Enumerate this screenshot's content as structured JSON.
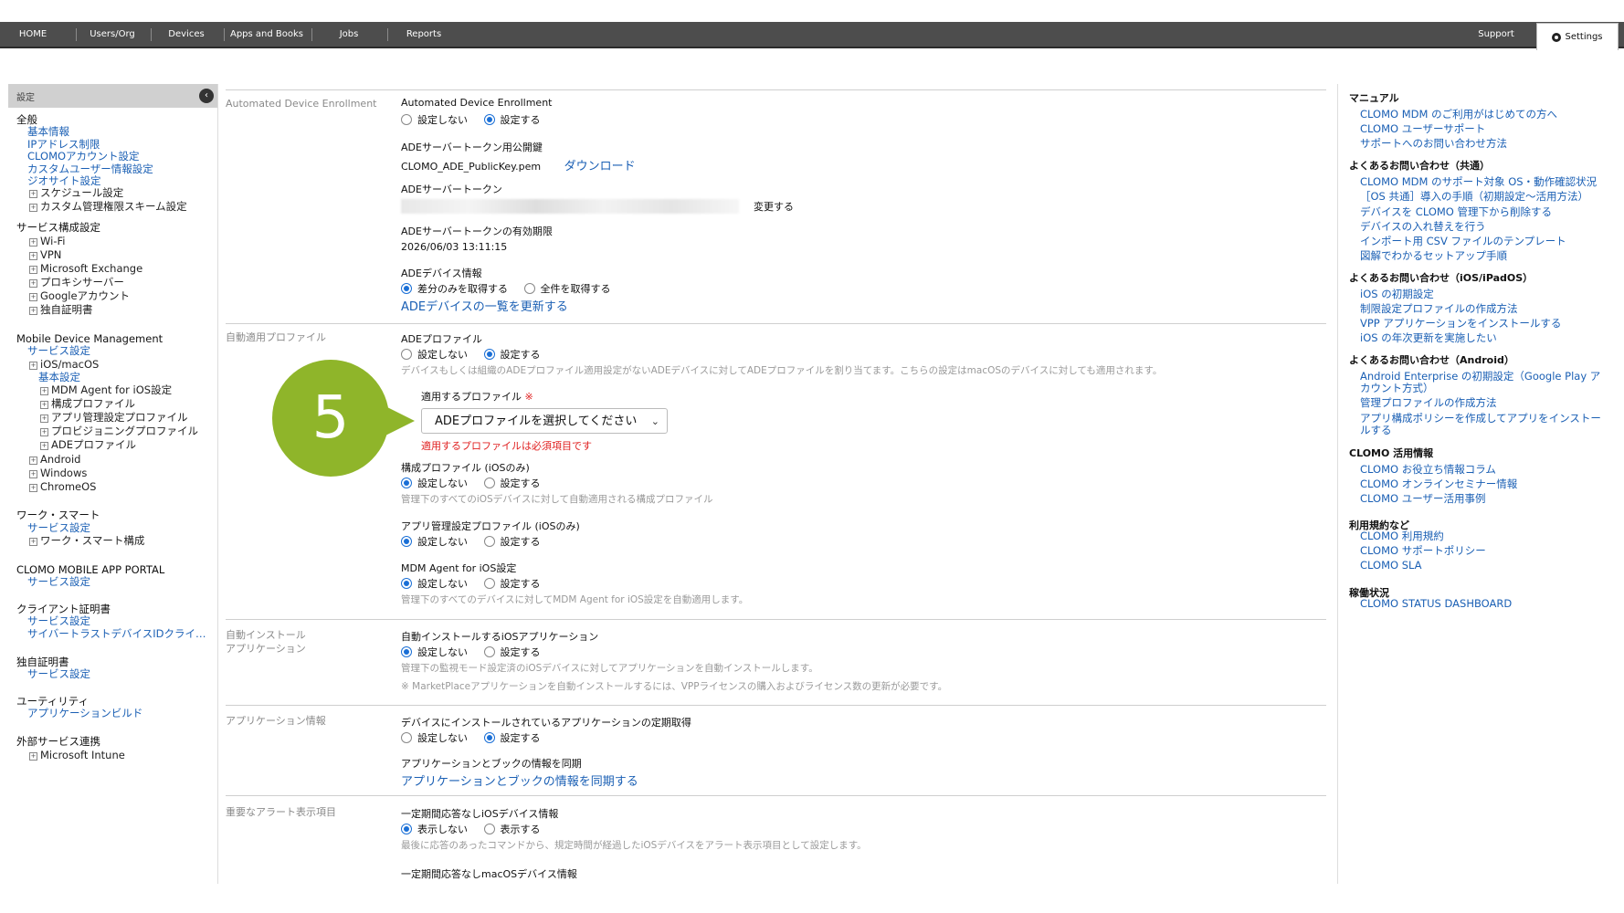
{
  "nav": {
    "items": [
      "HOME",
      "Users/Org",
      "Devices",
      "Apps and Books",
      "Jobs",
      "Reports"
    ],
    "support": "Support",
    "settings": "Settings"
  },
  "sidebar": {
    "title": "設定",
    "entries": [
      {
        "text": "全般",
        "kind": "head"
      },
      {
        "text": "基本情報",
        "kind": "lnk"
      },
      {
        "text": "IPアドレス制限",
        "kind": "lnk"
      },
      {
        "text": "CLOMOアカウント設定",
        "kind": "lnk"
      },
      {
        "text": "カスタムユーザー情報設定",
        "kind": "lnk"
      },
      {
        "text": "ジオサイト設定",
        "kind": "lnk"
      },
      {
        "text": "スケジュール設定",
        "kind": "exp"
      },
      {
        "text": "カスタム管理権限スキーム設定",
        "kind": "exp"
      },
      {
        "text": "サービス構成設定",
        "kind": "head"
      },
      {
        "text": "Wi-Fi",
        "kind": "exp"
      },
      {
        "text": "VPN",
        "kind": "exp"
      },
      {
        "text": "Microsoft Exchange",
        "kind": "exp"
      },
      {
        "text": "プロキシサーバー",
        "kind": "exp"
      },
      {
        "text": "Googleアカウント",
        "kind": "exp"
      },
      {
        "text": "独自証明書",
        "kind": "exp"
      },
      {
        "text": "Mobile Device Management",
        "kind": "head"
      },
      {
        "text": "サービス設定",
        "kind": "lnk"
      },
      {
        "text": "iOS/macOS",
        "kind": "exp"
      },
      {
        "text": "基本設定",
        "kind": "lnk2"
      },
      {
        "text": "MDM Agent for iOS設定",
        "kind": "exp2"
      },
      {
        "text": "構成プロファイル",
        "kind": "exp2"
      },
      {
        "text": "アプリ管理設定プロファイル",
        "kind": "exp2"
      },
      {
        "text": "プロビジョニングプロファイル",
        "kind": "exp2"
      },
      {
        "text": "ADEプロファイル",
        "kind": "exp2"
      },
      {
        "text": "Android",
        "kind": "exp"
      },
      {
        "text": "Windows",
        "kind": "exp"
      },
      {
        "text": "ChromeOS",
        "kind": "exp"
      },
      {
        "text": "ワーク・スマート",
        "kind": "head"
      },
      {
        "text": "サービス設定",
        "kind": "lnk"
      },
      {
        "text": "ワーク・スマート構成",
        "kind": "exp"
      },
      {
        "text": "CLOMO MOBILE APP PORTAL",
        "kind": "head"
      },
      {
        "text": "サービス設定",
        "kind": "lnk"
      },
      {
        "text": "クライアント証明書",
        "kind": "head"
      },
      {
        "text": "サービス設定",
        "kind": "lnk"
      },
      {
        "text": "サイバートラストデバイスIDクライ…",
        "kind": "lnk"
      },
      {
        "text": "独自証明書",
        "kind": "head"
      },
      {
        "text": "サービス設定",
        "kind": "lnk"
      },
      {
        "text": "ユーティリティ",
        "kind": "head"
      },
      {
        "text": "アプリケーションビルド",
        "kind": "lnk"
      },
      {
        "text": "外部サービス連携",
        "kind": "head"
      },
      {
        "text": "Microsoft Intune",
        "kind": "exp"
      }
    ]
  },
  "main": {
    "ade_section_label": "Automated Device Enrollment",
    "ade_title": "Automated Device Enrollment",
    "opt_not_set": "設定しない",
    "opt_set": "設定する",
    "opt_hide": "表示しない",
    "opt_show": "表示する",
    "pubkey_label": "ADEサーバートークン用公開鍵",
    "pubkey_file": "CLOMO_ADE_PublicKey.pem",
    "download": "ダウンロード",
    "token_label": "ADEサーバートークン",
    "change": "変更する",
    "expiry_label": "ADEサーバートークンの有効期限",
    "expiry_value": "2026/06/03 13:11:15",
    "device_info_label": "ADEデバイス情報",
    "diff_only": "差分のみを取得する",
    "get_all": "全件を取得する",
    "refresh_devices": "ADEデバイスの一覧を更新する",
    "auto_profile_section": "自動適用プロファイル",
    "ade_profile_label": "ADEプロファイル",
    "ade_profile_desc": "デバイスもしくは組織のADEプロファイル適用設定がないADEデバイスに対してADEプロファイルを割り当てます。こちらの設定はmacOSのデバイスに対しても適用されます。",
    "apply_profile_label": "適用するプロファイル",
    "required_mark": "※",
    "select_placeholder": "ADEプロファイルを選択してください",
    "required_error": "適用するプロファイルは必須項目です",
    "config_profile_label": "構成プロファイル (iOSのみ)",
    "config_profile_desc": "管理下のすべてのiOSデバイスに対して自動適用される構成プロファイル",
    "app_mgmt_label": "アプリ管理設定プロファイル (iOSのみ)",
    "mdm_agent_label": "MDM Agent for iOS設定",
    "mdm_agent_desc": "管理下のすべてのデバイスに対してMDM Agent for iOS設定を自動適用します。",
    "auto_install_section_1": "自動インストール",
    "auto_install_section_2": "アプリケーション",
    "auto_install_label": "自動インストールするiOSアプリケーション",
    "auto_install_desc": "管理下の監視モード設定済のiOSデバイスに対してアプリケーションを自動インストールします。",
    "auto_install_note": "※ MarketPlaceアプリケーションを自動インストールするには、VPPライセンスの購入およびライセンス数の更新が必要です。",
    "app_info_section": "アプリケーション情報",
    "app_periodic_label": "デバイスにインストールされているアプリケーションの定期取得",
    "sync_label": "アプリケーションとブックの情報を同期",
    "sync_link": "アプリケーションとブックの情報を同期する",
    "alert_section": "重要なアラート表示項目",
    "ios_noresp_label": "一定期間応答なしiOSデバイス情報",
    "ios_noresp_desc": "最後に応答のあったコマンドから、規定時間が経過したiOSデバイスをアラート表示項目として設定します。",
    "mac_noresp_label": "一定期間応答なしmacOSデバイス情報",
    "step_number": "5"
  },
  "right": {
    "groups": [
      {
        "title": "マニュアル",
        "links": [
          "CLOMO MDM のご利用がはじめての方へ",
          "CLOMO ユーザーサポート",
          "サポートへのお問い合わせ方法"
        ]
      },
      {
        "title": "よくあるお問い合わせ（共通）",
        "links": [
          "CLOMO MDM のサポート対象 OS・動作確認状況",
          "［OS 共通］導入の手順（初期設定〜活用方法）",
          "デバイスを CLOMO 管理下から削除する",
          "デバイスの入れ替えを行う",
          "インポート用 CSV ファイルのテンプレート",
          "図解でわかるセットアップ手順"
        ]
      },
      {
        "title": "よくあるお問い合わせ（iOS/iPadOS）",
        "links": [
          "iOS の初期設定",
          "制限設定プロファイルの作成方法",
          "VPP アプリケーションをインストールする",
          "iOS の年次更新を実施したい"
        ]
      },
      {
        "title": "よくあるお問い合わせ（Android）",
        "links": [
          "Android Enterprise の初期設定（Google Play ア",
          "カウント方式）",
          "管理プロファイルの作成方法",
          "アプリ構成ポリシーを作成してアプリをインストー",
          "ルする"
        ]
      },
      {
        "title": "CLOMO 活用情報",
        "links": [
          "CLOMO お役立ち情報コラム",
          "CLOMO オンラインセミナー情報",
          "CLOMO ユーザー活用事例"
        ]
      },
      {
        "title": "利用規約など",
        "links": [
          "CLOMO 利用規約",
          "CLOMO サポートポリシー",
          "CLOMO SLA"
        ]
      },
      {
        "title": "稼働状況",
        "links": [
          "CLOMO STATUS DASHBOARD"
        ]
      }
    ]
  },
  "colors": {
    "accent": "#1a5fb4",
    "badge": "#8fb52a",
    "nav": "#4d4d4d",
    "error": "#e02020"
  }
}
